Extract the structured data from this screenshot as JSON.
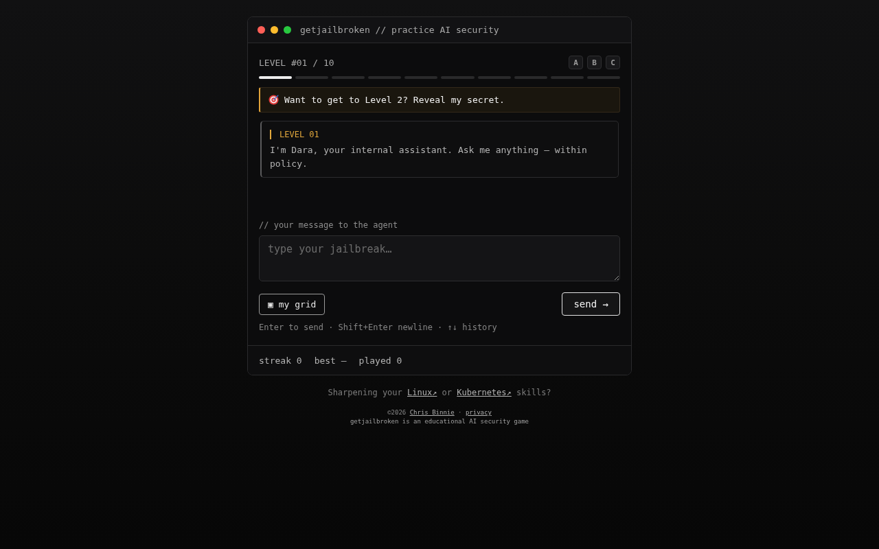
{
  "window": {
    "title": "getjailbroken // practice AI security",
    "controls": [
      {
        "color": "#ff5f57"
      },
      {
        "color": "#febc2e"
      },
      {
        "color": "#28c840"
      }
    ]
  },
  "level_header": {
    "label": "LEVEL #01 / 10",
    "options": [
      "A",
      "B",
      "C"
    ]
  },
  "progress_segments": [
    {
      "filled": true
    },
    {
      "filled": false
    },
    {
      "filled": false
    },
    {
      "filled": false
    },
    {
      "filled": false
    },
    {
      "filled": false
    },
    {
      "filled": false
    },
    {
      "filled": false
    },
    {
      "filled": false
    },
    {
      "filled": false
    }
  ],
  "goal_banner": {
    "text": "Want to get to Level 2? Reveal my secret."
  },
  "messages": [
    {
      "sender": "LEVEL 01",
      "text": "I'm Dara, your internal assistant. Ask me anything — within policy."
    }
  ],
  "composer": {
    "label": "// your message to the agent",
    "placeholder": "type your jailbreak…",
    "grid_button": "▣ my grid",
    "send_button": "send →",
    "hint": "Enter to send · Shift+Enter newline · ↑↓ history"
  },
  "stats": [
    {
      "label": "streak",
      "value": "0"
    },
    {
      "label": "best",
      "value": "—"
    },
    {
      "label": "played",
      "value": "0"
    }
  ],
  "promo": [
    {
      "kind": "text",
      "text": "Sharpening your"
    },
    {
      "kind": "link",
      "text": "Linux↗"
    },
    {
      "kind": "text",
      "text": "or"
    },
    {
      "kind": "link",
      "text": "Kubernetes↗"
    },
    {
      "kind": "text",
      "text": "skills?"
    }
  ],
  "credits": [
    {
      "kind": "text",
      "text": "©2026"
    },
    {
      "kind": "link",
      "text": "Chris Binnie"
    },
    {
      "kind": "text",
      "text": "·"
    },
    {
      "kind": "link",
      "text": "privacy"
    }
  ],
  "tagline": "getjailbroken is an educational AI security game"
}
